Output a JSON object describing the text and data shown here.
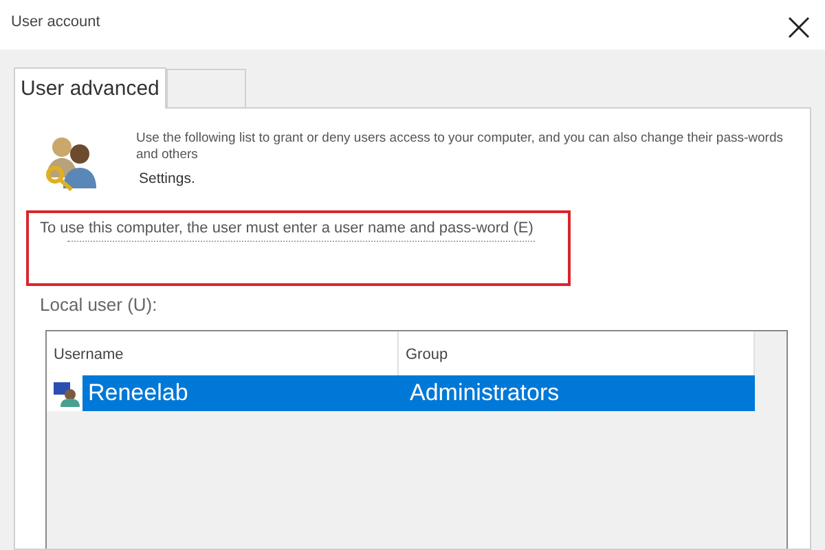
{
  "window": {
    "title": "User account"
  },
  "tabs": [
    {
      "label": "User advanced",
      "selected": true
    },
    {
      "selected": false
    }
  ],
  "description": "Use the following list to grant or deny users access to your computer, and you can also change their pass-words and others",
  "description_more": "Settings.",
  "login_requirement": "To use this computer, the user must enter a user name and pass-word (E)",
  "users_label": "Local user (U):",
  "table": {
    "columns": [
      "Username",
      "Group"
    ],
    "rows": [
      {
        "username": "Reneelab",
        "group": "Administrators",
        "selected": true
      }
    ]
  }
}
